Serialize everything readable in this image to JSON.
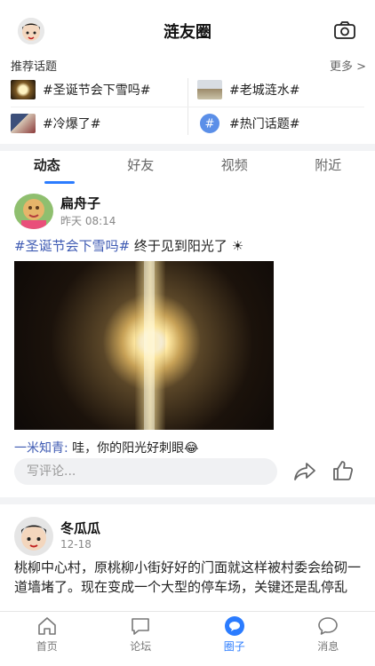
{
  "header": {
    "title": "涟友圈"
  },
  "topics": {
    "heading": "推荐话题",
    "more": "更多 >",
    "items": [
      {
        "label": "#圣诞节会下雪吗#"
      },
      {
        "label": "#老城涟水#"
      },
      {
        "label": "#冷爆了#"
      },
      {
        "label": "#热门话题#"
      }
    ]
  },
  "tabs": [
    {
      "label": "动态"
    },
    {
      "label": "好友"
    },
    {
      "label": "视频"
    },
    {
      "label": "附近"
    }
  ],
  "posts": [
    {
      "name": "扁舟子",
      "time": "昨天 08:14",
      "topic": "#圣诞节会下雪吗#",
      "text": " 终于见到阳光了 ☀",
      "comment_user": "一米知青:",
      "comment_text": " 哇，你的阳光好刺眼😂",
      "comment_placeholder": "写评论..."
    },
    {
      "name": "冬瓜瓜",
      "time": "12-18",
      "body": "桃柳中心村，原桃柳小街好好的门面就这样被村委会给砌一道墙堵了。现在变成一个大型的停车场，关键还是乱停乱"
    }
  ],
  "bottom_nav": [
    {
      "label": "首页"
    },
    {
      "label": "论坛"
    },
    {
      "label": "圈子"
    },
    {
      "label": "消息"
    }
  ]
}
